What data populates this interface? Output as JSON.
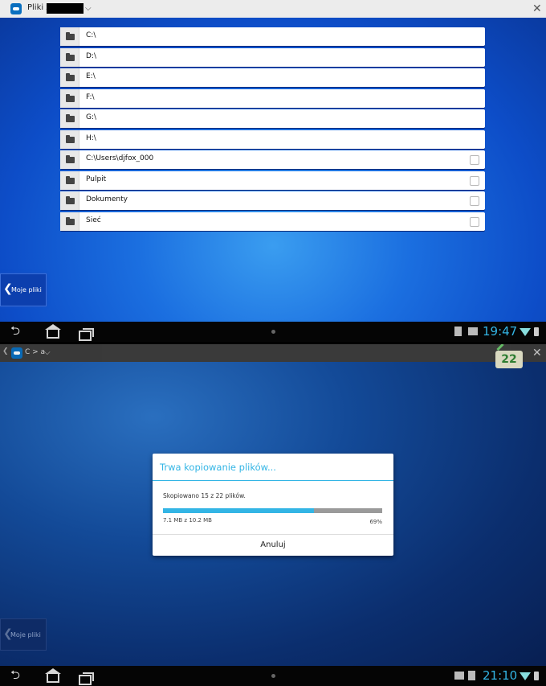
{
  "screen1": {
    "titlebar": {
      "title_prefix": "Pliki z",
      "close_glyph": "✕"
    },
    "list": [
      {
        "label": "C:\\",
        "checkbox": false
      },
      {
        "label": "D:\\",
        "checkbox": false
      },
      {
        "label": "E:\\",
        "checkbox": false
      },
      {
        "label": "F:\\",
        "checkbox": false
      },
      {
        "label": "G:\\",
        "checkbox": false
      },
      {
        "label": "H:\\",
        "checkbox": false
      },
      {
        "label": "C:\\Users\\djfox_000",
        "checkbox": true
      },
      {
        "label": "Pulpit",
        "checkbox": true
      },
      {
        "label": "Dokumenty",
        "checkbox": true
      },
      {
        "label": "Sieć",
        "checkbox": true
      }
    ],
    "my_files_button": "Moje pliki",
    "statusbar": {
      "clock": "19:47"
    }
  },
  "screen2": {
    "titlebar": {
      "title": "C > a",
      "close_glyph": "✕"
    },
    "badge_count": "22",
    "dialog": {
      "title": "Trwa kopiowanie plików...",
      "message": "Skopiowano 15 z 22 plików.",
      "size": "7.1 MB z 10.2 MB",
      "percent_text": "69%",
      "progress": 0.69,
      "cancel_label": "Anuluj"
    },
    "my_files_button": "Moje pliki",
    "statusbar": {
      "clock": "21:10"
    }
  },
  "colors": {
    "accent": "#33b5e5",
    "desktop_blue": "#1b6fe0"
  },
  "icons": {
    "folder": "folder-icon",
    "back": "back-icon",
    "home": "home-icon",
    "recent": "recent-apps-icon"
  }
}
